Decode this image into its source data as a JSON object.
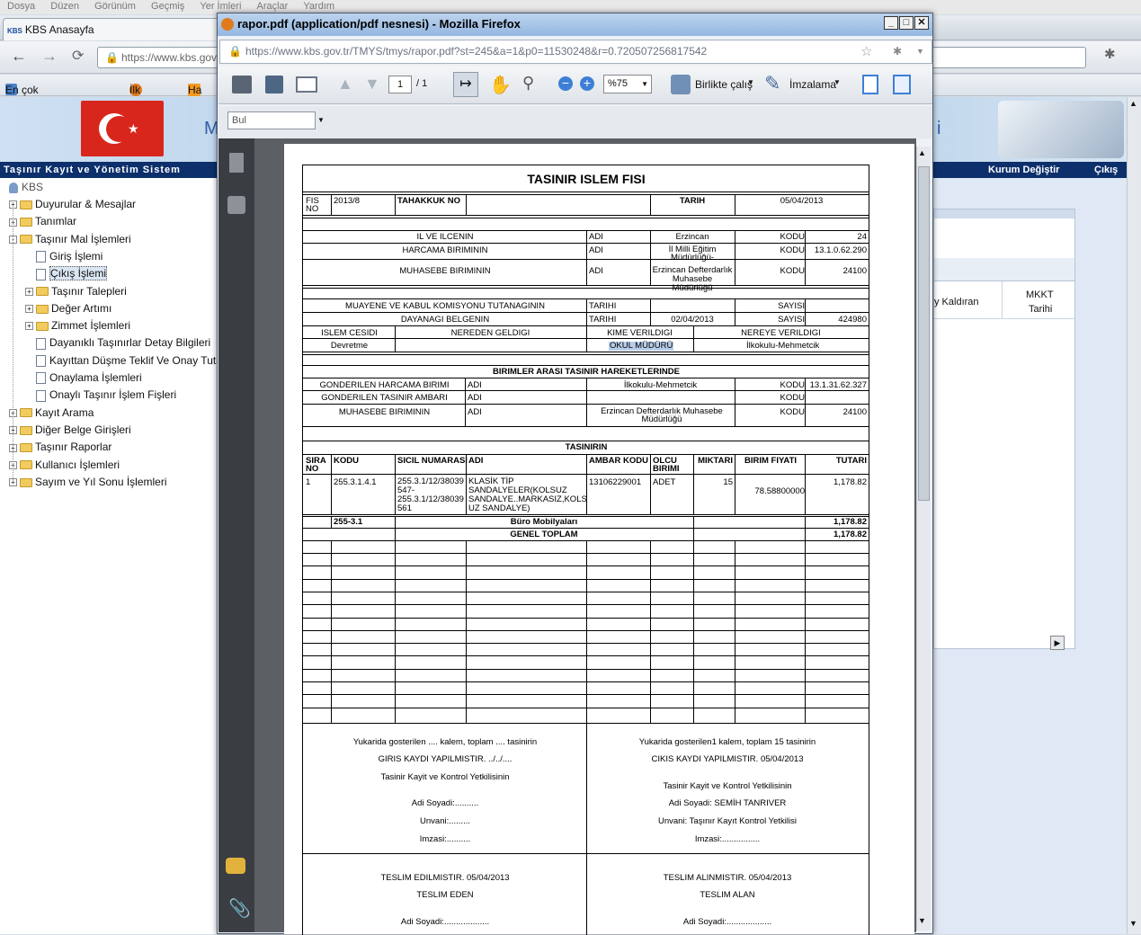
{
  "menu": [
    "Dosya",
    "Düzen",
    "Görünüm",
    "Geçmiş",
    "Yer İmleri",
    "Araçlar",
    "Yardım"
  ],
  "tab_title": "KBS Anasayfa",
  "url_prefix": "https://www.kbs.gov.",
  "bookmarks": [
    "En çok ziyaret edilenler",
    "İlk Adım",
    "Ha"
  ],
  "app_bar_title": "Taşınır Kayıt ve Yönetim Sistem",
  "app_bar_right": [
    "Kurum Değiştir",
    "Çıkış"
  ],
  "tree": {
    "root": "KBS",
    "items": [
      {
        "label": "Duyurular & Mesajlar",
        "type": "folder",
        "pm": "+"
      },
      {
        "label": "Tanımlar",
        "type": "folder",
        "pm": "+"
      },
      {
        "label": "Taşınır Mal İşlemleri",
        "type": "folder",
        "pm": "-"
      },
      {
        "label": "Giriş İşlemi",
        "type": "doc"
      },
      {
        "label": "Çıkış İşlemi",
        "type": "doc"
      },
      {
        "label": "Taşınır Talepleri",
        "type": "folder",
        "pm": "+"
      },
      {
        "label": "Değer Artımı",
        "type": "folder",
        "pm": "+"
      },
      {
        "label": "Zimmet İşlemleri",
        "type": "folder",
        "pm": "+"
      },
      {
        "label": "Dayanıklı Taşınırlar Detay Bilgileri",
        "type": "doc"
      },
      {
        "label": "Kayıttan Düşme Teklif Ve Onay Tutana",
        "type": "doc"
      },
      {
        "label": "Onaylama İşlemleri",
        "type": "doc"
      },
      {
        "label": "Onaylı Taşınır İşlem Fişleri",
        "type": "doc"
      },
      {
        "label": "Kayıt Arama",
        "type": "folder",
        "pm": "+"
      },
      {
        "label": "Diğer Belge Girişleri",
        "type": "folder",
        "pm": "+"
      },
      {
        "label": "Taşınır Raporlar",
        "type": "folder",
        "pm": "+"
      },
      {
        "label": "Kullanıcı İşlemleri",
        "type": "folder",
        "pm": "+"
      },
      {
        "label": "Sayım ve Yıl Sonu İşlemleri",
        "type": "folder",
        "pm": "+"
      }
    ]
  },
  "right_pane": {
    "col1": "y Kaldıran",
    "col2a": "MKKT",
    "col2b": "Tarihi",
    "banner_letter_left": "M",
    "banner_letter_right": "i"
  },
  "firefox": {
    "title": "rapor.pdf (application/pdf nesnesi) - Mozilla Firefox",
    "url": "https://www.kbs.gov.tr/TMYS/tmys/rapor.pdf?st=245&a=1&p0=11530248&r=0.720507256817542",
    "page_current": "1",
    "page_total": "/ 1",
    "zoom": "%75",
    "collab_label": "Birlikte çalış",
    "sign_label": "İmzalama",
    "find_placeholder": "Bul"
  },
  "form": {
    "title": "TASINIR ISLEM FISI",
    "fis_no_label": "FIS NO",
    "fis_no": "2013/8",
    "tahakkuk_label": "TAHAKKUK NO",
    "tarih_label": "TARIH",
    "tarih": "05/04/2013",
    "il_ilce_label": "IL VE ILCENIN",
    "adi": "ADI",
    "kodu": "KODU",
    "il_adi": "Erzincan",
    "il_kodu": "24",
    "harcama_label": "HARCAMA BIRIMININ",
    "harcama_adi": "İl Milli Eğitim Müdürlüğü-",
    "harcama_kodu": "13.1.0.62.290",
    "muhasebe_label": "MUHASEBE BIRIMININ",
    "muhasebe_adi": "Erzincan Defterdarlık Muhasebe Müdürlüğü",
    "muhasebe_kodu": "24100",
    "muayene_label": "MUAYENE VE KABUL KOMISYONU TUTANAGININ",
    "tarihi": "TARIHI",
    "sayisi": "SAYISI",
    "dayanagi_label": "DAYANAGI BELGENIN",
    "dayanagi_tarih": "02/04/2013",
    "dayanagi_sayi": "424980",
    "islem_cesidi": "ISLEM CESIDI",
    "nereden": "NEREDEN GELDIGI",
    "kime": "KIME VERILDIGI",
    "nereye": "NEREYE VERILDIGI",
    "islem_val": "Devretme",
    "kime_val": "OKUL MÜDÜRÜ",
    "nereye_val": "İlkokulu-Mehmetcik",
    "birimler_label": "BIRIMLER ARASI TASINIR HAREKETLERINDE",
    "gond_harcama": "GONDERILEN HARCAMA BIRIMI",
    "gond_harcama_adi": "İlkokulu-Mehmetcik",
    "gond_harcama_kodu": "13.1.31.62.327",
    "gond_ambar": "GONDERILEN TASINIR AMBARI",
    "muh2_label": "MUHASEBE BIRIMININ",
    "muh2_adi": "Erzincan Defterdarlık Muhasebe Müdürlüğü",
    "muh2_kodu": "24100",
    "tasinirin": "TASINIRIN",
    "cols": [
      "SIRA NO",
      "KODU",
      "SICIL NUMARASI",
      "ADI",
      "AMBAR KODU",
      "OLCU BIRIMI",
      "MIKTARI",
      "BIRIM FIYATI",
      "TUTARI"
    ],
    "row": {
      "sira": "1",
      "kodu": "255.3.1.4.1",
      "sicil": "255.3.1/12/38039 547- 255.3.1/12/38039 561",
      "adi": "KLASİK TİP SANDALYELER(KOLSUZ SANDALYE..MARKASIZ,KOLS UZ SANDALYE)",
      "ambar": "13106229001",
      "olcu": "ADET",
      "miktar": "15",
      "fiyat": "78.58800000",
      "tutar": "1,178.82"
    },
    "sub_kod": "255-3.1",
    "sub_label": "Büro Mobilyaları",
    "sub_total": "1,178.82",
    "genel_label": "GENEL TOPLAM",
    "genel_total": "1,178.82",
    "left_sig": [
      "Yukarida gosterilen .... kalem, toplam .... tasinirin",
      "GIRIS KAYDI YAPILMISTIR.    ../../....",
      "Tasinir Kayit ve Kontrol Yetkilisinin",
      "Adi Soyadi:..........",
      "Unvani:.........",
      "Imzasi:.........."
    ],
    "right_sig": [
      "Yukarida gosterilen1 kalem, toplam 15 tasinirin",
      "CIKIS KAYDI YAPILMISTIR.   05/04/2013",
      "Tasinir Kayit ve Kontrol Yetkilisinin",
      "Adi Soyadi: SEMİH TANRIVER",
      "Unvani: Taşınır Kayıt Kontrol Yetkilisi",
      "Imzasi:................"
    ],
    "teslim_edildi": "TESLIM EDILMISTIR.    05/04/2013",
    "teslim_eden": "TESLIM EDEN",
    "teslim_alindi": "TESLIM ALINMISTIR.    05/04/2013",
    "teslim_alan": "TESLIM ALAN",
    "adi_soyadi_l": "Adi Soyadi:...................",
    "adi_soyadi_r": "Adi Soyadi:..................."
  }
}
